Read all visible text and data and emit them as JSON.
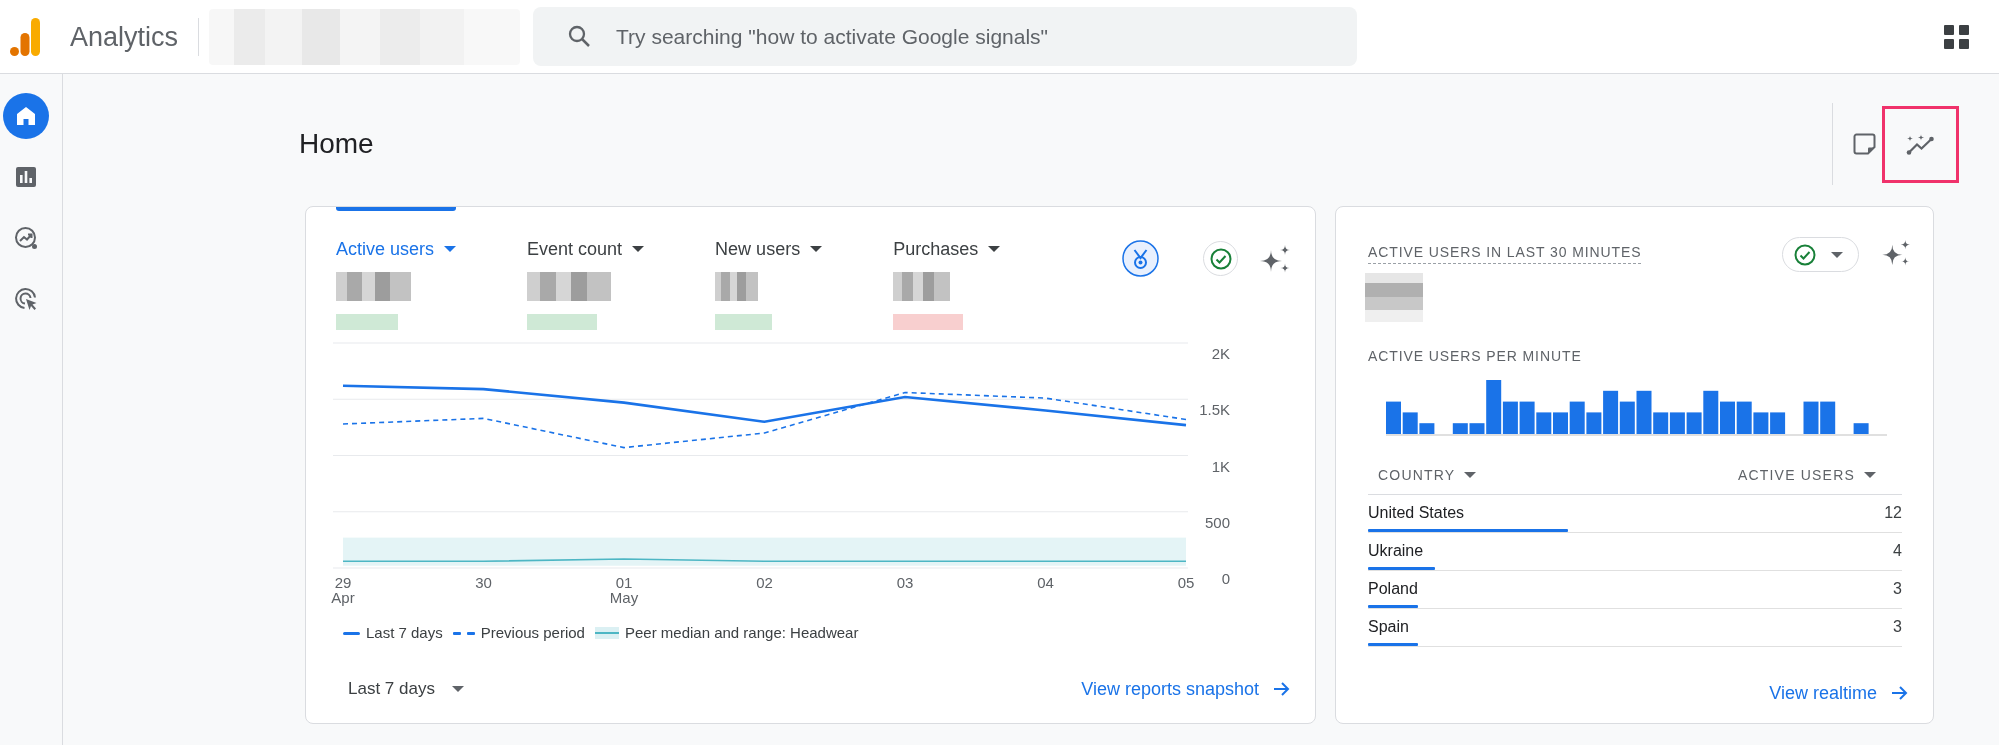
{
  "top_bar": {
    "product_name": "Analytics",
    "search": {
      "placeholder": "Try searching \"how to activate Google signals\""
    }
  },
  "nav_rail": {
    "items": [
      {
        "selected": true
      },
      {
        "selected": false
      },
      {
        "selected": false
      },
      {
        "selected": false
      }
    ]
  },
  "page_header": {
    "title": "Home",
    "insights_button": {
      "highlighted": true
    }
  },
  "overview_card": {
    "metrics": [
      {
        "label": "Active users",
        "selected": true,
        "declined": false
      },
      {
        "label": "Event count",
        "selected": false,
        "declined": false
      },
      {
        "label": "New users",
        "selected": false,
        "declined": false
      },
      {
        "label": "Purchases",
        "selected": false,
        "declined": true
      }
    ],
    "chart_data": {
      "type": "line",
      "categories": [
        "29 Apr",
        "30",
        "01 May",
        "02",
        "03",
        "04",
        "05"
      ],
      "series": [
        {
          "name": "Last 7 days",
          "color": "#1a73e8",
          "line_style": "solid",
          "values": [
            1620,
            1590,
            1470,
            1300,
            1520,
            1400,
            1270
          ]
        },
        {
          "name": "Previous period",
          "color": "#1a73e8",
          "line_style": "dashed",
          "values": [
            1280,
            1330,
            1070,
            1200,
            1560,
            1510,
            1320
          ]
        },
        {
          "name": "Peer median and range: Headwear",
          "color": "#4db6c4",
          "line_style": "solid",
          "values": [
            60,
            60,
            80,
            60,
            60,
            60,
            60
          ]
        }
      ],
      "bands": [
        {
          "axis": "y",
          "from": 20,
          "to": 270,
          "color": "#4db6c4"
        }
      ],
      "ylim": [
        0,
        2000
      ],
      "yticks": [
        {
          "value": 0,
          "label": "0"
        },
        {
          "value": 500,
          "label": "500"
        },
        {
          "value": 1000,
          "label": "1K"
        },
        {
          "value": 1500,
          "label": "1.5K"
        },
        {
          "value": 2000,
          "label": "2K"
        }
      ],
      "grid": true
    },
    "date_range": "Last 7 days",
    "link": "View reports snapshot"
  },
  "realtime_card": {
    "title": "ACTIVE USERS IN LAST 30 MINUTES",
    "per_minute_title": "ACTIVE USERS PER MINUTE",
    "table": {
      "columns": [
        "COUNTRY",
        "ACTIVE USERS"
      ],
      "rows": [
        {
          "country": "United States",
          "active_users": "12",
          "level": 0.375
        },
        {
          "country": "Ukraine",
          "active_users": "4",
          "level": 0.125
        },
        {
          "country": "Poland",
          "active_users": "3",
          "level": 0.094
        },
        {
          "country": "Spain",
          "active_users": "3",
          "level": 0.094
        }
      ]
    },
    "link": "View realtime"
  }
}
